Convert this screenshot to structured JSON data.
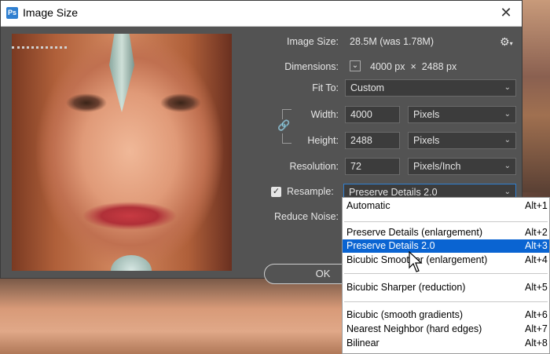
{
  "dialog": {
    "title": "Image Size",
    "close_glyph": "✕"
  },
  "image_size": {
    "label": "Image Size:",
    "value": "28.5M (was 1.78M)"
  },
  "dimensions": {
    "label": "Dimensions:",
    "width_value": "4000",
    "width_unit": "px",
    "times": "×",
    "height_value": "2488",
    "height_unit": "px"
  },
  "fit_to": {
    "label": "Fit To:",
    "value": "Custom"
  },
  "width": {
    "label": "Width:",
    "value": "4000",
    "unit": "Pixels"
  },
  "height": {
    "label": "Height:",
    "value": "2488",
    "unit": "Pixels"
  },
  "resolution": {
    "label": "Resolution:",
    "value": "72",
    "unit": "Pixels/Inch"
  },
  "resample": {
    "label": "Resample:",
    "checked": true,
    "value": "Preserve Details 2.0"
  },
  "reduce_noise": {
    "label": "Reduce Noise:"
  },
  "ok_label": "OK",
  "menu": {
    "items": [
      {
        "name": "Automatic",
        "key": "Alt+1"
      },
      {
        "name": "Preserve Details (enlargement)",
        "key": "Alt+2"
      },
      {
        "name": "Preserve Details 2.0",
        "key": "Alt+3",
        "selected": true
      },
      {
        "name": "Bicubic Smoother (enlargement)",
        "key": "Alt+4"
      },
      {
        "name": "Bicubic Sharper (reduction)",
        "key": "Alt+5"
      },
      {
        "name": "Bicubic (smooth gradients)",
        "key": "Alt+6"
      },
      {
        "name": "Nearest Neighbor (hard edges)",
        "key": "Alt+7"
      },
      {
        "name": "Bilinear",
        "key": "Alt+8"
      }
    ]
  },
  "colors": {
    "selection": "#0a64d2",
    "dialog_bg": "#535353"
  },
  "icons": [
    "gear-icon",
    "link-chain-icon",
    "chevron-down-icon",
    "close-icon",
    "cursor-icon"
  ]
}
